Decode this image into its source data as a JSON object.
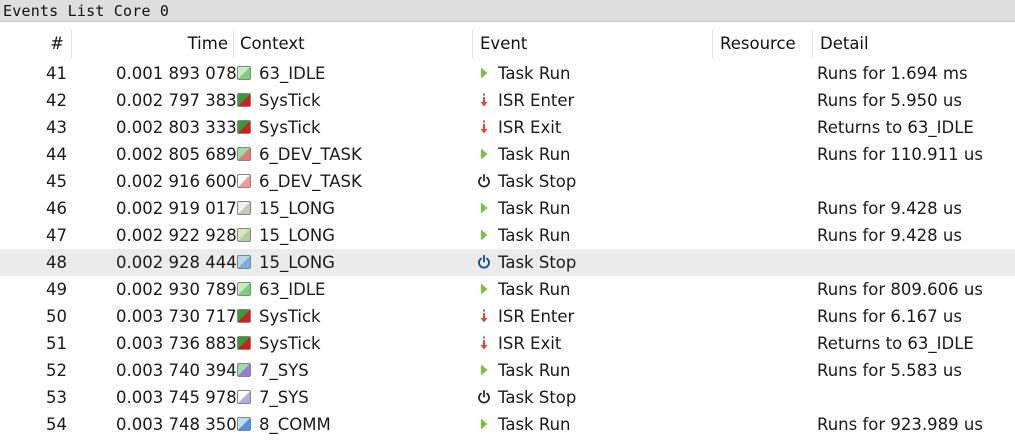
{
  "window": {
    "title": "Events List Core 0"
  },
  "columns": [
    {
      "key": "num",
      "label": "#"
    },
    {
      "key": "time",
      "label": "Time"
    },
    {
      "key": "context",
      "label": "Context"
    },
    {
      "key": "event",
      "label": "Event"
    },
    {
      "key": "resource",
      "label": "Resource"
    },
    {
      "key": "detail",
      "label": "Detail"
    }
  ],
  "selected_index": 7,
  "rows": [
    {
      "num": "41",
      "time": "0.001 893 078",
      "context": "63_IDLE",
      "swatch": {
        "style": "split",
        "a": "#c8eec8",
        "b": "#7ccf7c"
      },
      "event": "Task Run",
      "event_icon": "play-icon",
      "resource": "",
      "detail": "Runs for 1.694 ms"
    },
    {
      "num": "42",
      "time": "0.002 797 383",
      "context": "SysTick",
      "swatch": {
        "style": "split",
        "a": "#3a9a3a",
        "b": "#cc1f1f"
      },
      "event": "ISR Enter",
      "event_icon": "isr-enter-icon",
      "resource": "",
      "detail": "Runs for 5.950 us"
    },
    {
      "num": "43",
      "time": "0.002 803 333",
      "context": "SysTick",
      "swatch": {
        "style": "split",
        "a": "#3a9a3a",
        "b": "#cc1f1f"
      },
      "event": "ISR Exit",
      "event_icon": "isr-exit-icon",
      "resource": "",
      "detail": "Returns to 63_IDLE"
    },
    {
      "num": "44",
      "time": "0.002 805 689",
      "context": "6_DEV_TASK",
      "swatch": {
        "style": "split",
        "a": "#9fdc9f",
        "b": "#e67878"
      },
      "event": "Task Run",
      "event_icon": "play-icon",
      "resource": "",
      "detail": "Runs for 110.911 us"
    },
    {
      "num": "45",
      "time": "0.002 916 600",
      "context": "6_DEV_TASK",
      "swatch": {
        "style": "split",
        "a": "#ffffff",
        "b": "#ec9a9a"
      },
      "event": "Task Stop",
      "event_icon": "power-icon",
      "resource": "",
      "detail": ""
    },
    {
      "num": "46",
      "time": "0.002 919 017",
      "context": "15_LONG",
      "swatch": {
        "style": "split",
        "a": "#f2f2ec",
        "b": "#c8c8b8"
      },
      "event": "Task Run",
      "event_icon": "play-icon",
      "resource": "",
      "detail": "Runs for 9.428 us"
    },
    {
      "num": "47",
      "time": "0.002 922 928",
      "context": "15_LONG",
      "swatch": {
        "style": "split",
        "a": "#d8e6c0",
        "b": "#b8cca0"
      },
      "event": "Task Run",
      "event_icon": "play-icon",
      "resource": "",
      "detail": "Runs for 9.428 us"
    },
    {
      "num": "48",
      "time": "0.002 928 444",
      "context": "15_LONG",
      "swatch": {
        "style": "split",
        "a": "#b8d8f0",
        "b": "#7aaed6"
      },
      "event": "Task Stop",
      "event_icon": "power-icon-blue",
      "resource": "",
      "detail": ""
    },
    {
      "num": "49",
      "time": "0.002 930 789",
      "context": "63_IDLE",
      "swatch": {
        "style": "split",
        "a": "#c8eec8",
        "b": "#7ccf7c"
      },
      "event": "Task Run",
      "event_icon": "play-icon",
      "resource": "",
      "detail": "Runs for 809.606 us"
    },
    {
      "num": "50",
      "time": "0.003 730 717",
      "context": "SysTick",
      "swatch": {
        "style": "split",
        "a": "#3a9a3a",
        "b": "#cc1f1f"
      },
      "event": "ISR Enter",
      "event_icon": "isr-enter-icon",
      "resource": "",
      "detail": "Runs for 6.167 us"
    },
    {
      "num": "51",
      "time": "0.003 736 883",
      "context": "SysTick",
      "swatch": {
        "style": "split",
        "a": "#3a9a3a",
        "b": "#cc1f1f"
      },
      "event": "ISR Exit",
      "event_icon": "isr-exit-icon",
      "resource": "",
      "detail": "Returns to 63_IDLE"
    },
    {
      "num": "52",
      "time": "0.003 740 394",
      "context": "7_SYS",
      "swatch": {
        "style": "split",
        "a": "#9fdc9f",
        "b": "#9a7ad6"
      },
      "event": "Task Run",
      "event_icon": "play-icon",
      "resource": "",
      "detail": "Runs for 5.583 us"
    },
    {
      "num": "53",
      "time": "0.003 745 978",
      "context": "7_SYS",
      "swatch": {
        "style": "split",
        "a": "#ffffff",
        "b": "#b8a8e0"
      },
      "event": "Task Stop",
      "event_icon": "power-icon",
      "resource": "",
      "detail": ""
    },
    {
      "num": "54",
      "time": "0.003 748 350",
      "context": "8_COMM",
      "swatch": {
        "style": "split",
        "a": "#c0dcf4",
        "b": "#5a8ed6"
      },
      "event": "Task Run",
      "event_icon": "play-icon",
      "resource": "",
      "detail": "Runs for 923.989 us"
    }
  ]
}
